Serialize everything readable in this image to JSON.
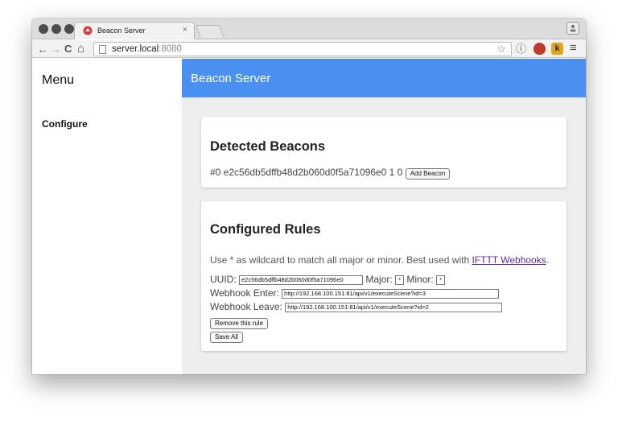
{
  "browser": {
    "tab_title": "Beacon Server",
    "tab_close": "×",
    "url_host": "server.local",
    "url_port": ":8080",
    "nav_back": "←",
    "nav_forward": "→",
    "nav_reload": "C",
    "nav_home": "⌂",
    "star": "☆",
    "menu": "≡",
    "ext_info": "ⓘ",
    "ext_k": "k"
  },
  "sidebar": {
    "title": "Menu",
    "items": [
      {
        "label": "Configure"
      }
    ]
  },
  "appbar": {
    "title": "Beacon Server"
  },
  "detected": {
    "title": "Detected Beacons",
    "beacon_text": "#0 e2c56db5dffb48d2b060d0f5a71096e0 1 0",
    "add_button": "Add Beacon"
  },
  "rules": {
    "title": "Configured Rules",
    "help_prefix": "Use * as wildcard to match all major or minor. Best used with ",
    "help_link": "IFTTT Webhooks",
    "help_suffix": ".",
    "uuid_label": "UUID:",
    "uuid_value": "e2c56db5dffb48d2b060d0f5a71096e0",
    "major_label": "Major:",
    "major_value": "*",
    "minor_label": "Minor:",
    "minor_value": "*",
    "enter_label": "Webhook Enter:",
    "enter_value": "http://192.168.100.151:81/api/v1/executeScene?id=3",
    "leave_label": "Webhook Leave:",
    "leave_value": "http://192.168.100.151:81/api/v1/executeScene?id=2",
    "remove_button": "Remove this rule",
    "save_button": "Save All"
  },
  "colors": {
    "appbar": "#4a90f0",
    "main_bg": "#eeeeee",
    "link": "#5a2a9e"
  }
}
